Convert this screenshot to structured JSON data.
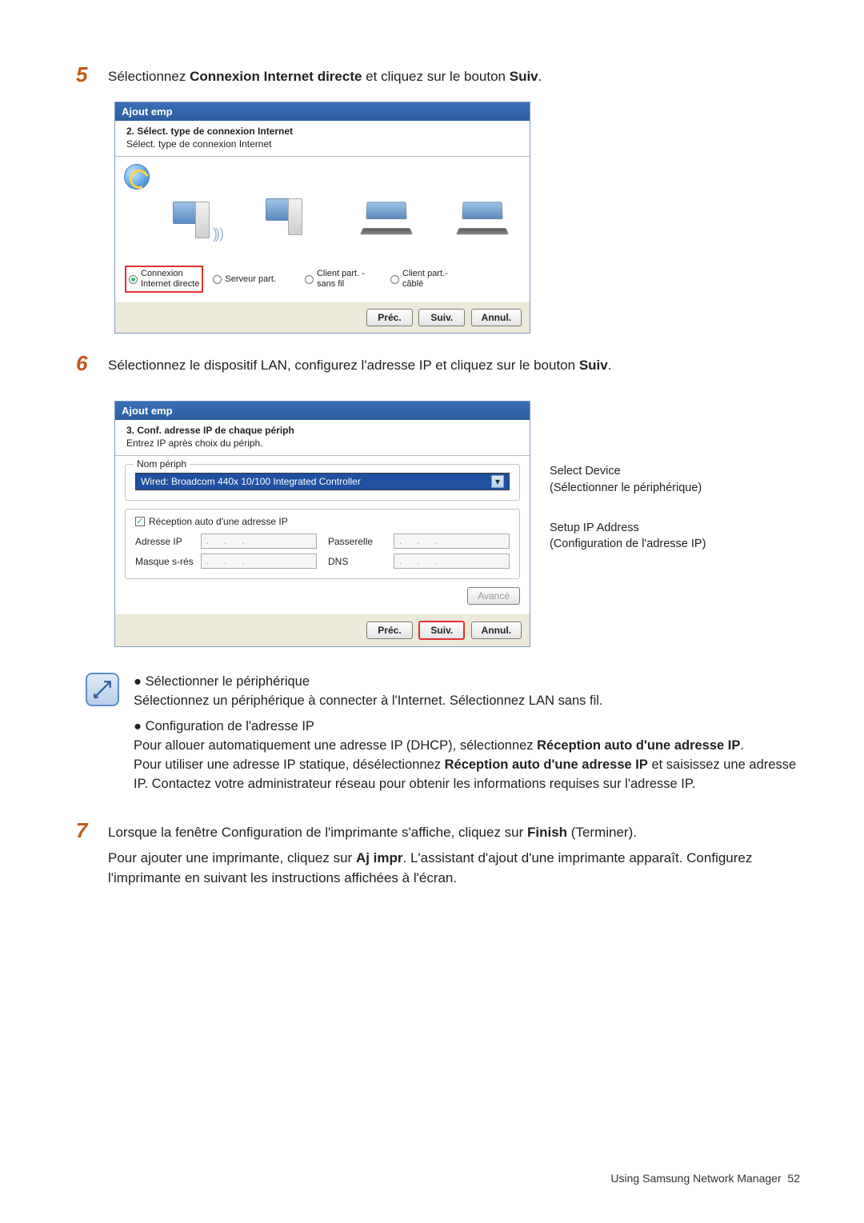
{
  "step5": {
    "num": "5",
    "text_pre": "Sélectionnez ",
    "text_link": "Connexion Internet directe",
    "text_mid": " et cliquez sur le bouton ",
    "text_btn": "Suiv",
    "text_post": "."
  },
  "dialog1": {
    "title": "Ajout emp",
    "head_title": "2. Sélect. type de connexion Internet",
    "head_sub": "Sélect. type de connexion Internet",
    "radios": {
      "r1": "Connexion Internet directe",
      "r1a": "Connexion",
      "r1b": "Internet directe",
      "r2": "Serveur part.",
      "r3a": "Client part. -",
      "r3b": "sans fil",
      "r4a": "Client part.-",
      "r4b": "câblé"
    },
    "buttons": {
      "prev": "Préc.",
      "next": "Suiv.",
      "cancel": "Annul."
    }
  },
  "step6": {
    "num": "6",
    "text_pre": "Sélectionnez le dispositif LAN, configurez l'adresse IP et cliquez sur le bouton ",
    "text_btn": "Suiv",
    "text_post": "."
  },
  "dialog2": {
    "title": "Ajout emp",
    "head_title": "3. Conf. adresse IP de chaque périph",
    "head_sub": "Entrez IP après choix du périph.",
    "fs1_legend": "Nom périph",
    "device_name": "Wired: Broadcom 440x 10/100 Integrated Controller",
    "chk_label": "Réception auto d'une adresse IP",
    "ip_lbl": "Adresse IP",
    "mask_lbl": "Masque s-rés",
    "gw_lbl": "Passerelle",
    "dns_lbl": "DNS",
    "adv_btn": "Avancé",
    "buttons": {
      "prev": "Préc.",
      "next": "Suiv.",
      "cancel": "Annul."
    }
  },
  "annotations": {
    "ann1a": "Select Device",
    "ann1b": "(Sélectionner le périphérique)",
    "ann2a": "Setup IP Address",
    "ann2b": "(Configuration de l'adresse IP)"
  },
  "note": {
    "h1": "Sélectionner le périphérique",
    "p1": "Sélectionnez un périphérique à connecter à l'Internet. Sélectionnez LAN sans fil.",
    "h2": "Configuration de l'adresse IP",
    "p2a": "Pour allouer automatiquement une adresse IP (DHCP), sélectionnez ",
    "p2b": "Réception auto d'une adresse IP",
    "p2c": ".",
    "p3a": "Pour utiliser une adresse IP statique, désélectionnez ",
    "p3b": "Réception auto d'une adresse IP",
    "p3c": " et saisissez une adresse IP. Contactez votre administrateur réseau pour obtenir les informations requises sur l'adresse IP."
  },
  "step7": {
    "num": "7",
    "p1a": "Lorsque la fenêtre Configuration de l'imprimante s'affiche, cliquez sur ",
    "p1b": "Finish",
    "p1c": " (Terminer).",
    "p2a": "Pour ajouter une imprimante, cliquez sur ",
    "p2b": "Aj impr",
    "p2c": ". L'assistant d'ajout d'une imprimante apparaît. Configurez l'imprimante en suivant les instructions affichées à l'écran."
  },
  "footer": {
    "text": "Using Samsung Network Manager",
    "page": "52"
  }
}
